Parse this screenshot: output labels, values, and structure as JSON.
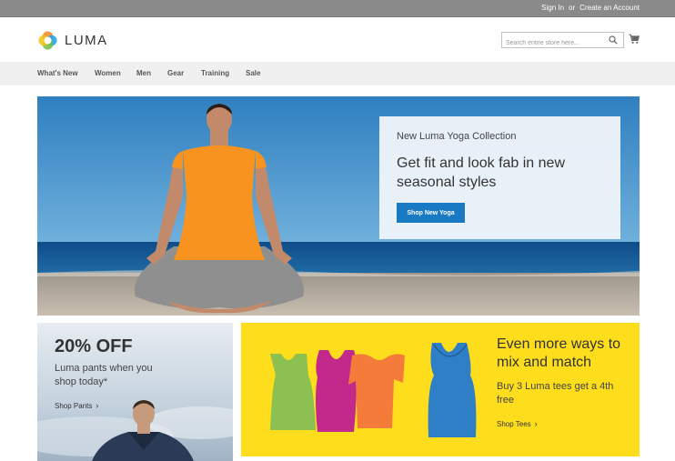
{
  "topbar": {
    "sign_in": "Sign In",
    "or": "or",
    "create_account": "Create an Account"
  },
  "header": {
    "logo_text": "LUMA",
    "search_placeholder": "Search entire store here...",
    "icons": [
      "luma-logo-icon",
      "search-icon",
      "cart-icon"
    ]
  },
  "nav": {
    "items": [
      "What's New",
      "Women",
      "Men",
      "Gear",
      "Training",
      "Sale"
    ]
  },
  "hero": {
    "eyebrow": "New Luma Yoga Collection",
    "title": "Get fit and look fab in new seasonal styles",
    "button": "Shop New Yoga"
  },
  "promo_left": {
    "headline": "20% OFF",
    "text": "Luma pants when you shop today*",
    "link": "Shop Pants"
  },
  "promo_right": {
    "headline": "Even more ways to mix and match",
    "text": "Buy 3 Luma tees get a 4th free",
    "link": "Shop Tees"
  },
  "colors": {
    "topbar": "#8a8a8a",
    "nav_bg": "#f0f0f0",
    "primary_button": "#1979c3",
    "promo_yellow": "#fddd1c",
    "tee_green": "#8cc152",
    "tee_magenta": "#c2298a",
    "tee_orange": "#f47b3a",
    "tank_blue": "#2f7fc7"
  }
}
